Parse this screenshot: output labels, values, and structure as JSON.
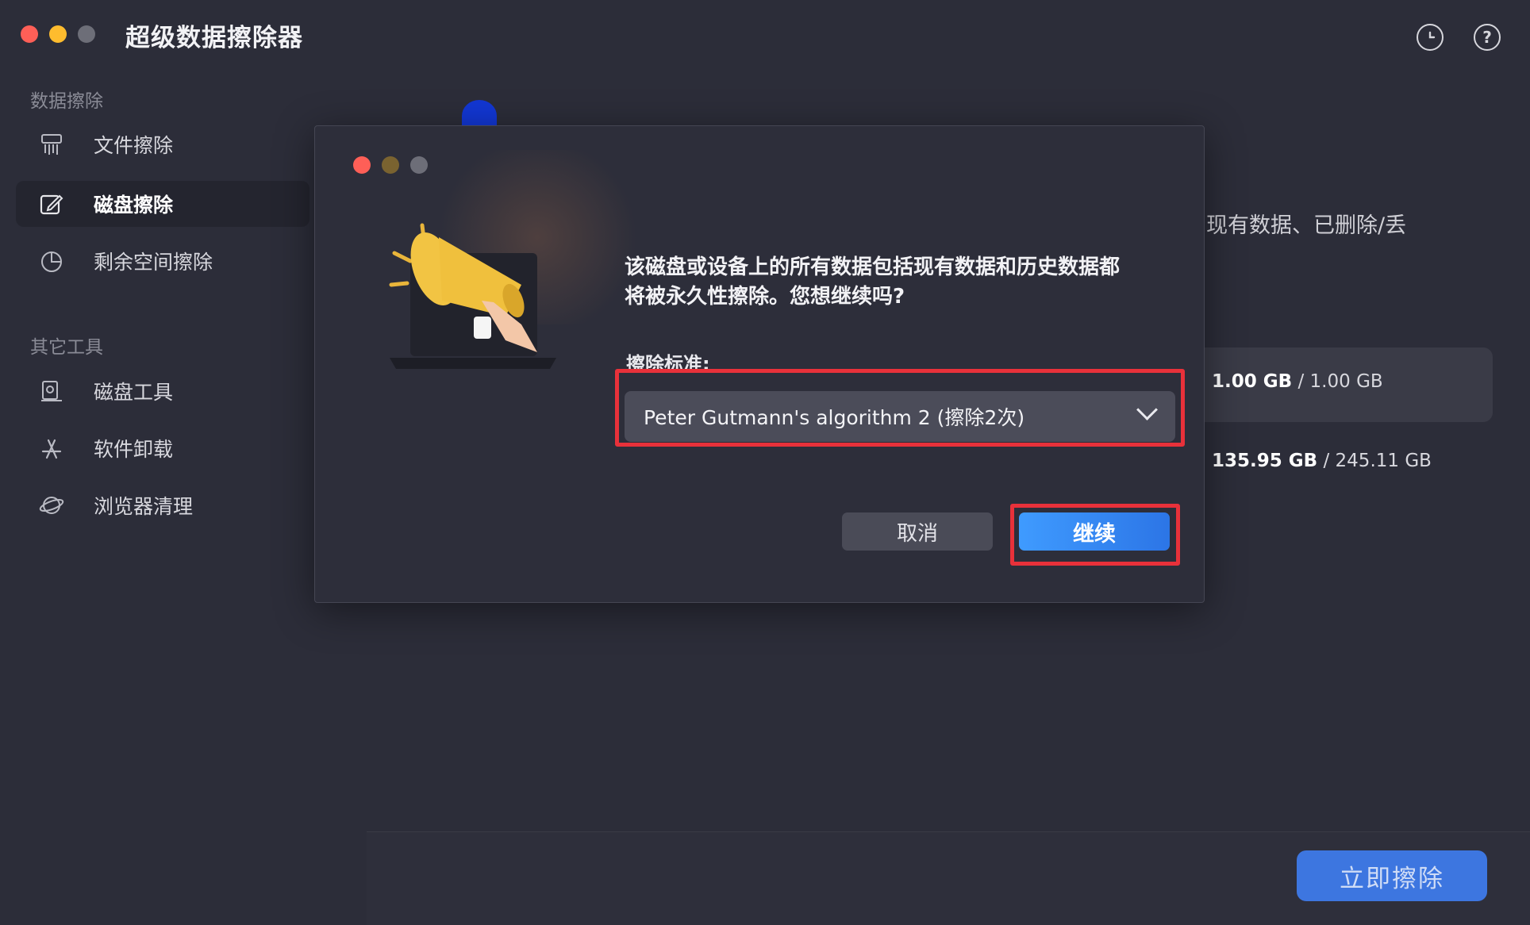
{
  "window": {
    "title": "超级数据擦除器",
    "header_icons": [
      {
        "name": "clock-icon"
      },
      {
        "name": "help-icon",
        "glyph": "?"
      }
    ]
  },
  "sidebar": {
    "sections": [
      {
        "label": "数据擦除",
        "items": [
          {
            "label": "文件擦除",
            "icon": "shredder-icon",
            "active": false
          },
          {
            "label": "磁盘擦除",
            "icon": "disk-erase-icon",
            "active": true
          },
          {
            "label": "剩余空间擦除",
            "icon": "pie-chart-icon",
            "active": false
          }
        ]
      },
      {
        "label": "其它工具",
        "items": [
          {
            "label": "磁盘工具",
            "icon": "disk-tool-icon",
            "active": false
          },
          {
            "label": "软件卸载",
            "icon": "app-store-icon",
            "active": false
          },
          {
            "label": "浏览器清理",
            "icon": "browser-planet-icon",
            "active": false
          }
        ]
      }
    ]
  },
  "content": {
    "description_fragment": "现有数据、已删除/丢",
    "disks": [
      {
        "used": "1.00 GB",
        "total": "/ 1.00 GB",
        "selected": true
      },
      {
        "used": "135.95 GB",
        "total": "/ 245.11 GB",
        "selected": false
      }
    ],
    "erase_now_label": "立即擦除"
  },
  "dialog": {
    "message_line1": "该磁盘或设备上的所有数据包括现有数据和历史数据都",
    "message_line2": "将被永久性擦除。您想继续吗?",
    "standard_label": "擦除标准:",
    "standard_value": "Peter Gutmann's algorithm 2 (擦除2次)",
    "cancel_label": "取消",
    "continue_label": "继续",
    "illustration": "megaphone-laptop-illustration"
  },
  "colors": {
    "accent_blue": "#2c75e6",
    "highlight_red": "#e8313a",
    "background": "#2c2d39"
  }
}
